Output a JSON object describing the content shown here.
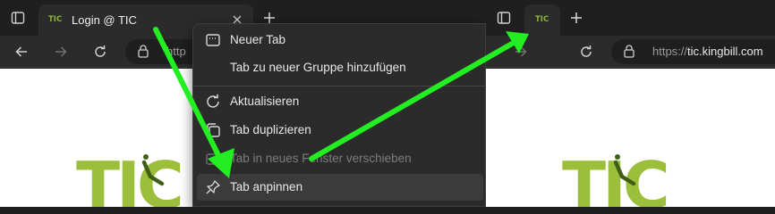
{
  "left_window": {
    "tab": {
      "favicon_text": "TIC",
      "title": "Login @ TIC"
    },
    "address_prefix": "http"
  },
  "right_window": {
    "tab": {
      "favicon_text": "TIC"
    },
    "address_prefix": "https://",
    "address_host": "tic.kingbill.com"
  },
  "logo_text": "TIC",
  "context_menu": {
    "items": [
      {
        "label": "Neuer Tab",
        "icon": "new-tab-icon",
        "disabled": false
      },
      {
        "label": "Tab zu neuer Gruppe hinzufügen",
        "icon": "",
        "disabled": false
      },
      {
        "label": "Aktualisieren",
        "icon": "refresh-icon",
        "disabled": false
      },
      {
        "label": "Tab duplizieren",
        "icon": "duplicate-icon",
        "disabled": false
      },
      {
        "label": "Tab in neues Fenster verschieben",
        "icon": "move-window-icon",
        "disabled": true
      },
      {
        "label": "Tab anpinnen",
        "icon": "pin-icon",
        "disabled": false,
        "highlighted": true
      }
    ]
  },
  "colors": {
    "arrow": "#22ee22",
    "logo_green": "#9bbf3b",
    "clock_hand": "#3f5f16"
  }
}
